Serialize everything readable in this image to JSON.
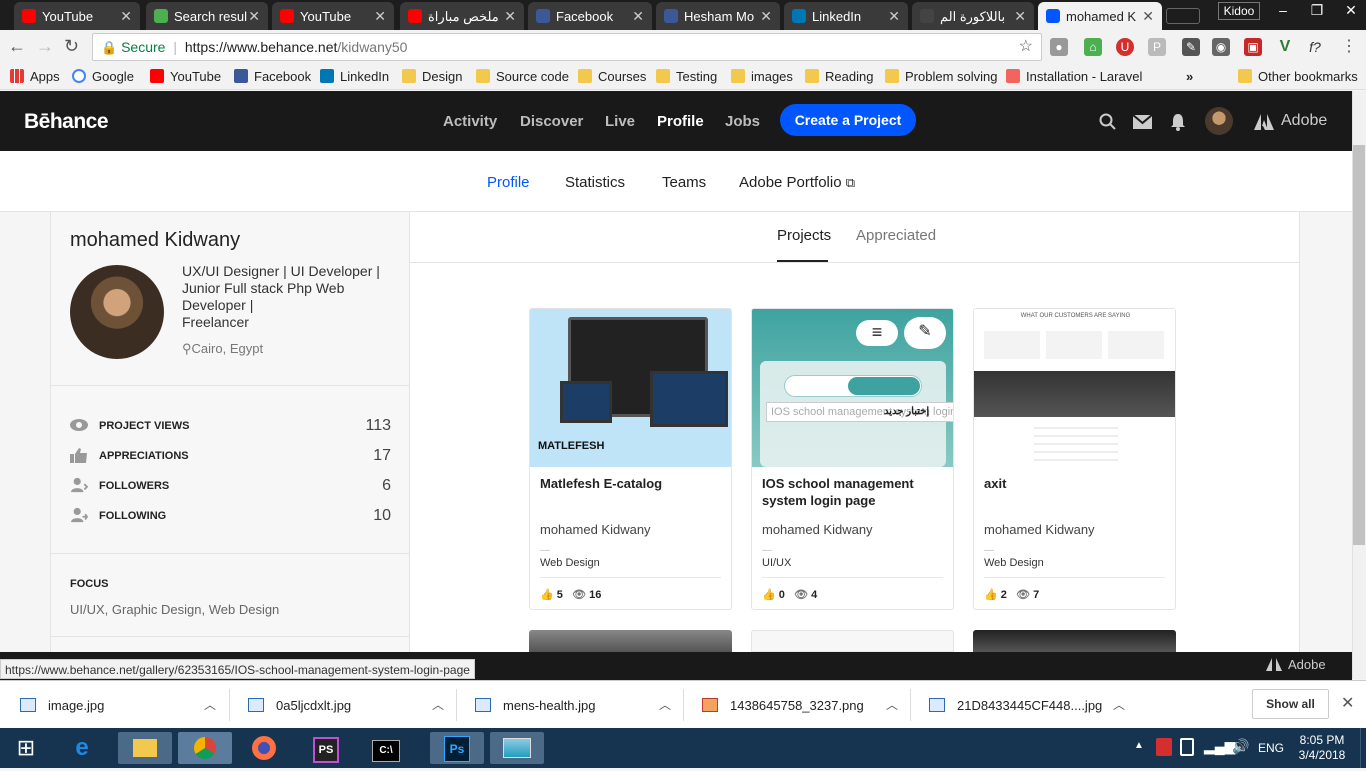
{
  "browser": {
    "tabs": [
      {
        "label": "YouTube",
        "fav_color": "#ff0000"
      },
      {
        "label": "Search resul",
        "fav_color": "#4caf50"
      },
      {
        "label": "YouTube",
        "fav_color": "#ff0000"
      },
      {
        "label": "ملخص مباراة",
        "fav_color": "#ff0000"
      },
      {
        "label": "Facebook",
        "fav_color": "#3b5998"
      },
      {
        "label": "Hesham Mo",
        "fav_color": "#3b5998"
      },
      {
        "label": "LinkedIn",
        "fav_color": "#0077b5"
      },
      {
        "label": "باللاكورة الم",
        "fav_color": "#444444"
      },
      {
        "label": "mohamed K",
        "fav_color": "#0057ff"
      }
    ],
    "profile_name": "Kidoo",
    "secure_label": "Secure",
    "url_host": "https://www.behance.net",
    "url_path": "/kidwany50",
    "bookmarks": [
      {
        "label": "Apps",
        "type": "apps"
      },
      {
        "label": "Google",
        "type": "google"
      },
      {
        "label": "YouTube",
        "type": "youtube"
      },
      {
        "label": "Facebook",
        "type": "facebook"
      },
      {
        "label": "LinkedIn",
        "type": "linkedin"
      },
      {
        "label": "Design",
        "type": "folder"
      },
      {
        "label": "Source code",
        "type": "folder"
      },
      {
        "label": "Courses",
        "type": "folder"
      },
      {
        "label": "Testing",
        "type": "folder"
      },
      {
        "label": "images",
        "type": "folder"
      },
      {
        "label": "Reading",
        "type": "folder"
      },
      {
        "label": "Problem solving",
        "type": "folder"
      },
      {
        "label": "Installation - Laravel",
        "type": "laravel"
      }
    ],
    "bookmarks_more": "»",
    "other_bookmarks": "Other bookmarks"
  },
  "behance": {
    "logo": "Bēhance",
    "nav": [
      "Activity",
      "Discover",
      "Live",
      "Profile",
      "Jobs"
    ],
    "create_button": "Create a Project",
    "adobe_label": "Adobe",
    "subnav": [
      "Profile",
      "Statistics",
      "Teams",
      "Adobe Portfolio"
    ]
  },
  "profile": {
    "name": "mohamed Kidwany",
    "bio_lines": [
      "UX/UI Designer | UI Developer |",
      "Junior Full stack Php Web",
      "Developer |",
      "Freelancer"
    ],
    "location": "Cairo, Egypt",
    "stats": [
      {
        "label": "PROJECT VIEWS",
        "value": "113",
        "icon": "eye-icon"
      },
      {
        "label": "APPRECIATIONS",
        "value": "17",
        "icon": "thumbs-up-icon"
      },
      {
        "label": "FOLLOWERS",
        "value": "6",
        "icon": "followers-icon"
      },
      {
        "label": "FOLLOWING",
        "value": "10",
        "icon": "following-icon"
      }
    ],
    "focus_title": "FOCUS",
    "focus_value": "UI/UX, Graphic Design, Web Design"
  },
  "projects": {
    "tabs": [
      "Projects",
      "Appreciated"
    ],
    "cards": [
      {
        "title": "Matlefesh E-catalog",
        "owner": "mohamed Kidwany",
        "field": "Web Design",
        "likes": "5",
        "views": "16",
        "thumb_text": "MATLEFESH",
        "thumb_color": "#bfe3f7"
      },
      {
        "title": "IOS school management system login page",
        "owner": "mohamed Kidwany",
        "field": "UI/UX",
        "likes": "0",
        "views": "4",
        "thumb_text": "إختبار جديد",
        "thumb_color": "#3ea3a0"
      },
      {
        "title": "axit",
        "owner": "mohamed Kidwany",
        "field": "Web Design",
        "likes": "2",
        "views": "7",
        "thumb_text": "WHAT OUR CUSTOMERS ARE SAYING",
        "thumb_color": "#ffffff"
      }
    ],
    "tooltip": "IOS school management system login page"
  },
  "status_url": "https://www.behance.net/gallery/62353165/IOS-school-management-system-login-page",
  "status_adobe": "Adobe",
  "downloads": {
    "items": [
      "image.jpg",
      "0a5ljcdxlt.jpg",
      "mens-health.jpg",
      "1438645758_3237.png",
      "21D8433445CF448....jpg"
    ],
    "show_all": "Show all"
  },
  "taskbar": {
    "lang": "ENG",
    "time": "8:05 PM",
    "date": "3/4/2018"
  }
}
